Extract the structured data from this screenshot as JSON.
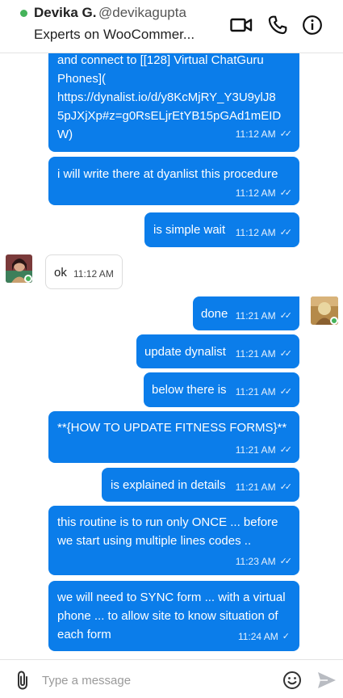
{
  "header": {
    "name": "Devika G.",
    "handle": "@devikagupta",
    "subtitle": "Experts on WooCommer...",
    "icons": [
      "video-icon",
      "phone-icon",
      "info-icon"
    ]
  },
  "messages": [
    {
      "dir": "out",
      "text_lines": [
        "and connect to [[128] Virtual ChatGuru",
        "Phones](",
        "https://dynalist.io/d/y8KcMjRY_Y3U9ylJ8",
        "5pJXjXp#z=g0RsELjrEtYB15pGAd1mEID",
        "W)"
      ],
      "time": "11:12 AM",
      "status": "read"
    },
    {
      "dir": "out",
      "text": "i will write there at dyanlist this procedure",
      "time": "11:12 AM",
      "status": "read"
    },
    {
      "dir": "out",
      "text": "is simple wait",
      "time": "11:12 AM",
      "status": "read"
    },
    {
      "dir": "in",
      "text": "ok",
      "time": "11:12 AM"
    },
    {
      "dir": "out",
      "text": "done",
      "time": "11:21 AM",
      "status": "read"
    },
    {
      "dir": "out",
      "text": "update dynalist",
      "time": "11:21 AM",
      "status": "read"
    },
    {
      "dir": "out",
      "text": "below there is",
      "time": "11:21 AM",
      "status": "read"
    },
    {
      "dir": "out",
      "text": "**{HOW TO UPDATE FITNESS FORMS}**",
      "time": "11:21 AM",
      "status": "read"
    },
    {
      "dir": "out",
      "text": "is explained in details",
      "time": "11:21 AM",
      "status": "read"
    },
    {
      "dir": "out",
      "text_lines": [
        "this routine is to run only ONCE ... before",
        "we start using multiple lines codes .."
      ],
      "time": "11:23 AM",
      "status": "read"
    },
    {
      "dir": "out",
      "text_lines": [
        "we will need to SYNC form ... with a virtual",
        "phone ... to allow site to know situation of",
        "each form"
      ],
      "time": "11:24 AM",
      "status": "sent"
    }
  ],
  "composer": {
    "placeholder": "Type a message",
    "icons": [
      "attachment-icon",
      "emoji-icon",
      "send-icon"
    ]
  },
  "colors": {
    "outgoing_bubble": "#0b7dea",
    "online": "#44b35a"
  }
}
